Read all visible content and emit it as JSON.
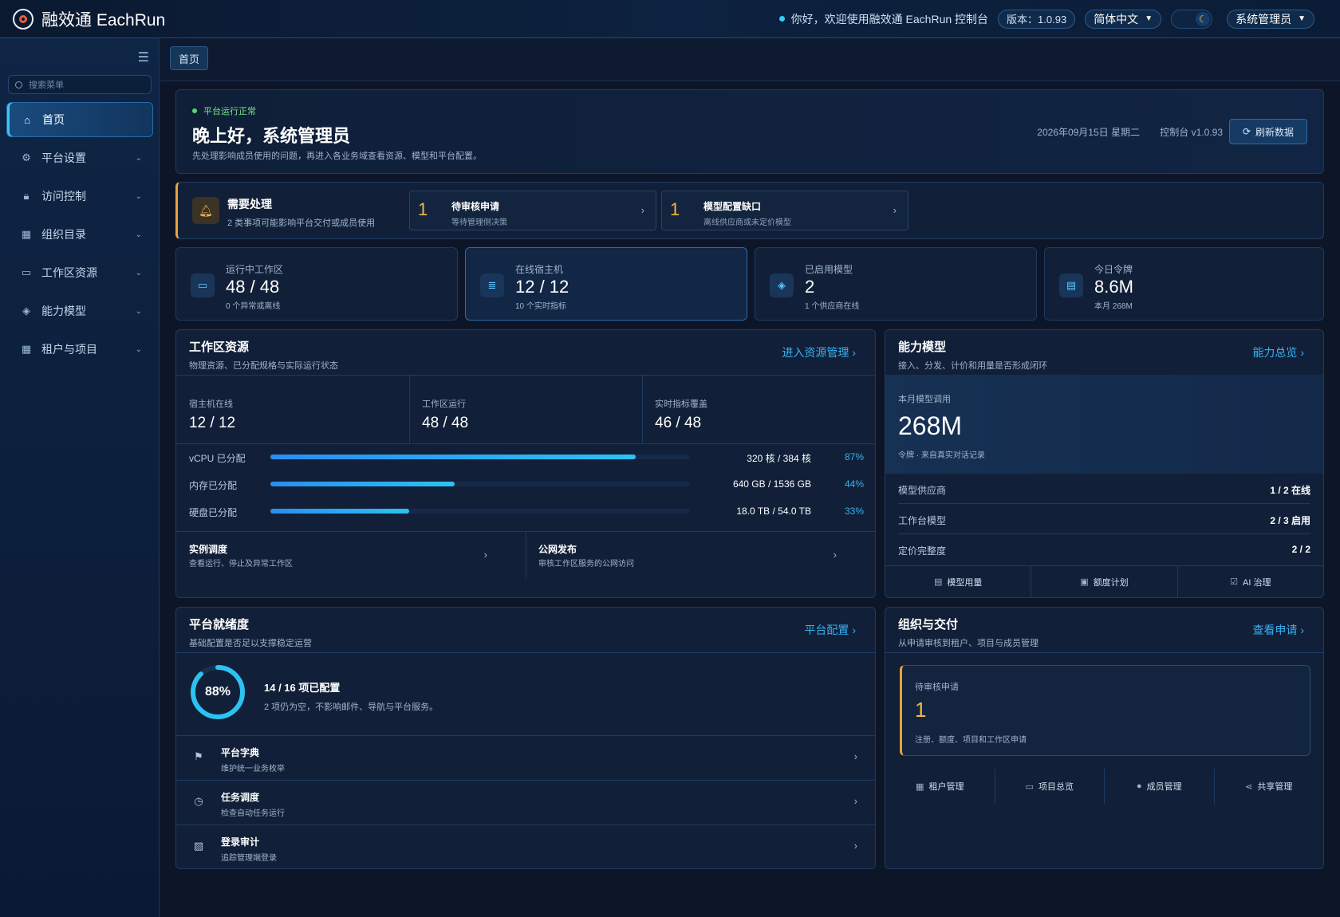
{
  "header": {
    "app_name": "融效通 EachRun",
    "greeting": "你好，欢迎使用融效通 EachRun 控制台",
    "version": "版本：1.0.93",
    "language": "简体中文",
    "user": "系统管理员"
  },
  "sidebar": {
    "search_placeholder": "搜索菜单",
    "items": [
      {
        "label": "首页",
        "icon": "home-icon",
        "active": true
      },
      {
        "label": "平台设置",
        "icon": "gear-icon"
      },
      {
        "label": "访问控制",
        "icon": "lock-icon"
      },
      {
        "label": "组织目录",
        "icon": "building-icon"
      },
      {
        "label": "工作区资源",
        "icon": "monitor-icon"
      },
      {
        "label": "能力模型",
        "icon": "chip-icon"
      },
      {
        "label": "租户与项目",
        "icon": "building-icon"
      }
    ]
  },
  "breadcrumb": {
    "tab": "首页"
  },
  "welcome": {
    "status": "平台运行正常",
    "title": "晚上好，系统管理员",
    "subtitle": "先处理影响成员使用的问题，再进入各业务域查看资源、模型和平台配置。",
    "date": "2026年09月15日 星期二",
    "console_version": "控制台 v1.0.93",
    "refresh_label": "刷新数据"
  },
  "alert": {
    "title": "需要处理",
    "subtitle": "2 类事项可能影响平台交付或成员使用",
    "items": [
      {
        "count": "1",
        "title": "待审核申请",
        "desc": "等待管理侧决策"
      },
      {
        "count": "1",
        "title": "模型配置缺口",
        "desc": "离线供应商或未定价模型"
      }
    ]
  },
  "stats": [
    {
      "label": "运行中工作区",
      "value": "48 / 48",
      "sub": "0 个异常或离线",
      "icon": "monitor-icon"
    },
    {
      "label": "在线宿主机",
      "value": "12 / 12",
      "sub": "10 个实时指标",
      "icon": "database-icon"
    },
    {
      "label": "已启用模型",
      "value": "2",
      "sub": "1 个供应商在线",
      "icon": "chip-icon"
    },
    {
      "label": "今日令牌",
      "value": "8.6M",
      "sub": "本月 268M",
      "icon": "chart-icon"
    }
  ],
  "workspace": {
    "title": "工作区资源",
    "subtitle": "物理资源、已分配规格与实际运行状态",
    "link": "进入资源管理",
    "stats": [
      {
        "label": "宿主机在线",
        "value": "12 / 12"
      },
      {
        "label": "工作区运行",
        "value": "48 / 48"
      },
      {
        "label": "实时指标覆盖",
        "value": "46 / 48"
      }
    ],
    "bars": [
      {
        "label": "vCPU 已分配",
        "amount": "320 核 / 384 核",
        "pct": "87%",
        "fraction": 0.87
      },
      {
        "label": "内存已分配",
        "amount": "640 GB / 1536 GB",
        "pct": "44%",
        "fraction": 0.44
      },
      {
        "label": "硬盘已分配",
        "amount": "18.0 TB / 54.0 TB",
        "pct": "33%",
        "fraction": 0.33
      }
    ],
    "links": [
      {
        "title": "实例调度",
        "desc": "查看运行、停止及异常工作区"
      },
      {
        "title": "公网发布",
        "desc": "审核工作区服务的公网访问"
      }
    ]
  },
  "capability": {
    "title": "能力模型",
    "subtitle": "接入、分发、计价和用量是否形成闭环",
    "link": "能力总览",
    "hero_label": "本月模型调用",
    "hero_value": "268M",
    "hero_sub": "令牌 · 来自真实对话记录",
    "rows": [
      {
        "key": "模型供应商",
        "value": "1 / 2 在线"
      },
      {
        "key": "工作台模型",
        "value": "2 / 3 启用"
      },
      {
        "key": "定价完整度",
        "value": "2 / 2"
      }
    ],
    "footer": [
      {
        "label": "模型用量",
        "icon": "chart-icon"
      },
      {
        "label": "额度计划",
        "icon": "document-icon"
      },
      {
        "label": "AI 治理",
        "icon": "check-icon"
      }
    ]
  },
  "readiness": {
    "title": "平台就绪度",
    "subtitle": "基础配置是否足以支撑稳定运营",
    "link": "平台配置",
    "percent_label": "88%",
    "percent": 0.88,
    "configured": "14 / 16 项已配置",
    "desc": "2 项仍为空，不影响邮件、导航与平台服务。",
    "rows": [
      {
        "title": "平台字典",
        "desc": "维护统一业务枚举",
        "icon": "bookmark-icon"
      },
      {
        "title": "任务调度",
        "desc": "检查自动任务运行",
        "icon": "timer-icon"
      },
      {
        "title": "登录审计",
        "desc": "追踪管理端登录",
        "icon": "audit-icon"
      }
    ]
  },
  "org": {
    "title": "组织与交付",
    "subtitle": "从申请审核到租户、项目与成员管理",
    "link": "查看申请",
    "pending_label": "待审核申请",
    "pending_value": "1",
    "pending_desc": "注册、额度、项目和工作区申请",
    "footer": [
      {
        "label": "租户管理",
        "icon": "building-icon"
      },
      {
        "label": "项目总览",
        "icon": "folder-icon"
      },
      {
        "label": "成员管理",
        "icon": "user-icon"
      },
      {
        "label": "共享管理",
        "icon": "share-icon"
      }
    ]
  },
  "colors": {
    "accent": "#3ab0f0",
    "warning": "#f0b84a",
    "success": "#55d870",
    "background": "#0d1628"
  }
}
